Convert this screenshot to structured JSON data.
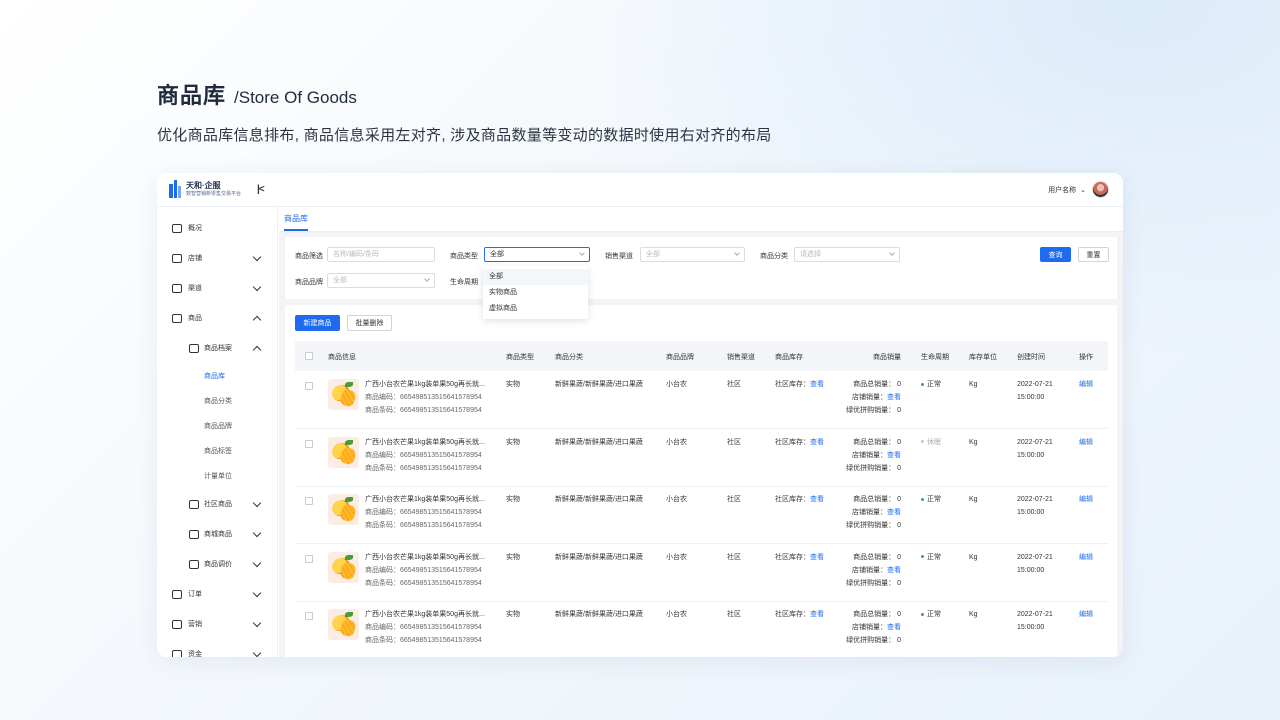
{
  "heading": {
    "title_zh": "商品库",
    "title_en": "/Store Of Goods",
    "description": "优化商品库信息排布, 商品信息采用左对齐, 涉及商品数量等变动的数据时使用右对齐的布局"
  },
  "app": {
    "logo_title": "天和·企服",
    "logo_subtitle": "数智营销新零售交易平台",
    "user_name": "用户名称"
  },
  "sidebar": {
    "items": [
      {
        "label": "概况",
        "icon": "dashboard-icon"
      },
      {
        "label": "店铺",
        "icon": "store-icon"
      },
      {
        "label": "渠道",
        "icon": "channel-icon"
      },
      {
        "label": "商品",
        "icon": "goods-icon"
      },
      {
        "label": "商品档案",
        "icon": "archive-icon"
      },
      {
        "label": "商品库"
      },
      {
        "label": "商品分类"
      },
      {
        "label": "商品品牌"
      },
      {
        "label": "商品标签"
      },
      {
        "label": "计量单位"
      },
      {
        "label": "社区商品",
        "icon": "community-icon"
      },
      {
        "label": "商城商品",
        "icon": "mall-icon"
      },
      {
        "label": "商品调价",
        "icon": "price-icon"
      },
      {
        "label": "订单",
        "icon": "order-icon"
      },
      {
        "label": "营销",
        "icon": "marketing-icon"
      },
      {
        "label": "资金",
        "icon": "funds-icon"
      }
    ]
  },
  "tabs": {
    "active": "商品库"
  },
  "filters": {
    "goods_filter_label": "商品筛选",
    "goods_filter_placeholder": "名称/编码/条码",
    "type_label": "商品类型",
    "type_value": "全部",
    "channel_label": "销售渠道",
    "channel_placeholder": "全部",
    "category_label": "商品分类",
    "category_placeholder": "请选择",
    "brand_label": "商品品牌",
    "brand_placeholder": "全部",
    "lifecycle_label": "生命周期",
    "query_button": "查询",
    "reset_button": "重置",
    "type_options": [
      "全部",
      "实物商品",
      "虚拟商品"
    ]
  },
  "toolbar": {
    "new_button": "新建商品",
    "batch_delete_button": "批量删除"
  },
  "table": {
    "columns": [
      "商品信息",
      "商品类型",
      "商品分类",
      "商品品牌",
      "销售渠道",
      "商品库存",
      "商品销量",
      "生命周期",
      "库存单位",
      "创建时间",
      "操作"
    ],
    "rows": [
      {
        "name": "广西小台农芒果1kg装单果50g再长就...",
        "code": "商品编码：665498513515641578954",
        "barcode": "商品条码：665498513515641578954",
        "type": "实物",
        "category": "新鲜果蔬/新鲜果蔬/进口果蔬",
        "brand": "小台农",
        "channel": "社区",
        "stock_label": "社区库存：",
        "stock_link": "查看",
        "sales_total": "商品总销量： 0",
        "sales_store_label": "店铺销量：",
        "sales_store_link": "查看",
        "sales_group": "绿优拼购销量： 0",
        "lifecycle": "正常",
        "lifecycle_color": "#2bb34a",
        "unit": "Kg",
        "date": "2022-07-21",
        "time": "15:00:00",
        "action": "编辑"
      },
      {
        "name": "广西小台农芒果1kg装单果50g再长就...",
        "code": "商品编码：665498513515641578954",
        "barcode": "商品条码：665498513515641578954",
        "type": "实物",
        "category": "新鲜果蔬/新鲜果蔬/进口果蔬",
        "brand": "小台农",
        "channel": "社区",
        "stock_label": "社区库存：",
        "stock_link": "查看",
        "sales_total": "商品总销量： 0",
        "sales_store_label": "店铺销量：",
        "sales_store_link": "查看",
        "sales_group": "绿优拼购销量： 0",
        "lifecycle": "休眠",
        "lifecycle_color": "#c5c9cf",
        "unit": "Kg",
        "date": "2022-07-21",
        "time": "15:00:00",
        "action": "编辑"
      },
      {
        "name": "广西小台农芒果1kg装单果50g再长就...",
        "code": "商品编码：665498513515641578954",
        "barcode": "商品条码：665498513515641578954",
        "type": "实物",
        "category": "新鲜果蔬/新鲜果蔬/进口果蔬",
        "brand": "小台农",
        "channel": "社区",
        "stock_label": "社区库存：",
        "stock_link": "查看",
        "sales_total": "商品总销量： 0",
        "sales_store_label": "店铺销量：",
        "sales_store_link": "查看",
        "sales_group": "绿优拼购销量： 0",
        "lifecycle": "正常",
        "lifecycle_color": "#2bb34a",
        "unit": "Kg",
        "date": "2022-07-21",
        "time": "15:00:00",
        "action": "编辑"
      },
      {
        "name": "广西小台农芒果1kg装单果50g再长就...",
        "code": "商品编码：665498513515641578954",
        "barcode": "商品条码：665498513515641578954",
        "type": "实物",
        "category": "新鲜果蔬/新鲜果蔬/进口果蔬",
        "brand": "小台农",
        "channel": "社区",
        "stock_label": "社区库存：",
        "stock_link": "查看",
        "sales_total": "商品总销量： 0",
        "sales_store_label": "店铺销量：",
        "sales_store_link": "查看",
        "sales_group": "绿优拼购销量： 0",
        "lifecycle": "正常",
        "lifecycle_color": "#2bb34a",
        "unit": "Kg",
        "date": "2022-07-21",
        "time": "15:00:00",
        "action": "编辑"
      },
      {
        "name": "广西小台农芒果1kg装单果50g再长就...",
        "code": "商品编码：665498513515641578954",
        "barcode": "商品条码：665498513515641578954",
        "type": "实物",
        "category": "新鲜果蔬/新鲜果蔬/进口果蔬",
        "brand": "小台农",
        "channel": "社区",
        "stock_label": "社区库存：",
        "stock_link": "查看",
        "sales_total": "商品总销量： 0",
        "sales_store_label": "店铺销量：",
        "sales_store_link": "查看",
        "sales_group": "绿优拼购销量： 0",
        "lifecycle": "正常",
        "lifecycle_color": "#2bb34a",
        "unit": "Kg",
        "date": "2022-07-21",
        "time": "15:00:00",
        "action": "编辑"
      }
    ]
  },
  "colors": {
    "primary": "#1e6bf0",
    "status_normal": "#2bb34a",
    "status_dormant": "#c5c9cf"
  }
}
